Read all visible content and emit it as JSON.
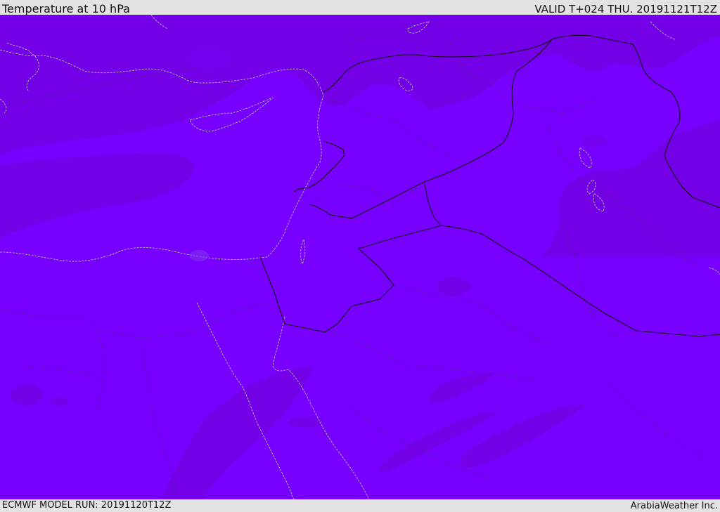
{
  "header": {
    "title": "Temperature at 10 hPa",
    "valid": "VALID T+024 THU. 20191121T12Z"
  },
  "footer": {
    "model_run": "ECMWF MODEL RUN: 20191120T12Z",
    "credit": "ArabiaWeather Inc."
  },
  "map": {
    "colors": {
      "base": "#7800ff",
      "band_a": "#7300e6",
      "band_b": "#7500f0",
      "coastline": "#a8a8a8",
      "border": "#111111",
      "admin_border": "#4a2a8a"
    }
  }
}
